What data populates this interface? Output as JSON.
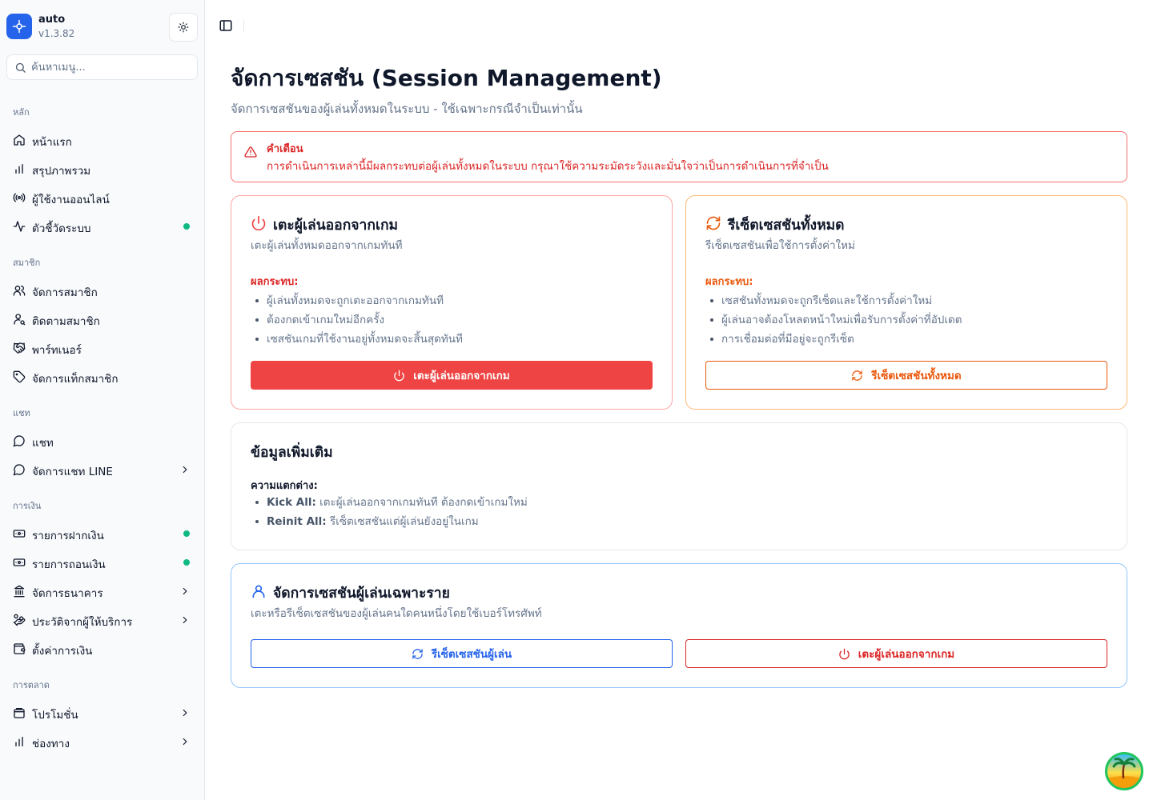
{
  "brand": {
    "name": "auto",
    "version": "v1.3.82"
  },
  "search": {
    "placeholder": "ค้นหาเมนู..."
  },
  "sections": {
    "main": "หลัก",
    "members": "สมาชิก",
    "chat": "แชท",
    "finance": "การเงิน",
    "marketing": "การตลาด"
  },
  "nav": {
    "home": "หน้าแรก",
    "overview": "สรุปภาพรวม",
    "online": "ผู้ใช้งานออนไลน์",
    "metrics": "ตัวชี้วัดระบบ",
    "members": "จัดการสมาชิก",
    "follow": "ติดตามสมาชิก",
    "partner": "พาร์ทเนอร์",
    "tags": "จัดการแท็กสมาชิก",
    "chat": "แชท",
    "line": "จัดการแชท LINE",
    "deposit": "รายการฝากเงิน",
    "withdraw": "รายการถอนเงิน",
    "bank": "จัดการธนาคาร",
    "provider": "ประวัติจากผู้ให้บริการ",
    "finance_settings": "ตั้งค่าการเงิน",
    "promo": "โปรโมชั่น",
    "channel": "ช่องทาง"
  },
  "page": {
    "title": "จัดการเซสชัน (Session Management)",
    "subtitle": "จัดการเซสชันของผู้เล่นทั้งหมดในระบบ - ใช้เฉพาะกรณีจำเป็นเท่านั้น"
  },
  "alert": {
    "title": "คำเตือน",
    "text": "การดำเนินการเหล่านี้มีผลกระทบต่อผู้เล่นทั้งหมดในระบบ กรุณาใช้ความระมัดระวังและมั่นใจว่าเป็นการดำเนินการที่จำเป็น"
  },
  "kick_card": {
    "title": "เตะผู้เล่นออกจากเกม",
    "desc": "เตะผู้เล่นทั้งหมดออกจากเกมทันที",
    "impact_label": "ผลกระทบ:",
    "bullets": [
      "ผู้เล่นทั้งหมดจะถูกเตะออกจากเกมทันที",
      "ต้องกดเข้าเกมใหม่อีกครั้ง",
      "เซสชันเกมที่ใช้งานอยู่ทั้งหมดจะสิ้นสุดทันที"
    ],
    "button": "เตะผู้เล่นออกจากเกม"
  },
  "reset_card": {
    "title": "รีเซ็ตเซสชันทั้งหมด",
    "desc": "รีเซ็ตเซสชันเพื่อใช้การตั้งค่าใหม่",
    "impact_label": "ผลกระทบ:",
    "bullets": [
      "เซสชันทั้งหมดจะถูกรีเซ็ตและใช้การตั้งค่าใหม่",
      "ผู้เล่นอาจต้องโหลดหน้าใหม่เพื่อรับการตั้งค่าที่อัปเดต",
      "การเชื่อมต่อที่มีอยู่จะถูกรีเซ็ต"
    ],
    "button": "รีเซ็ตเซสชันทั้งหมด"
  },
  "info_card": {
    "title": "ข้อมูลเพิ่มเติม",
    "diff_label": "ความแตกต่าง:",
    "items": [
      {
        "term": "Kick All:",
        "text": "เตะผู้เล่นออกจากเกมทันที ต้องกดเข้าเกมใหม่"
      },
      {
        "term": "Reinit All:",
        "text": "รีเซ็ตเซสชันแต่ผู้เล่นยังอยู่ในเกม"
      }
    ]
  },
  "player_card": {
    "title": "จัดการเซสชันผู้เล่นเฉพาะราย",
    "desc": "เตะหรือรีเซ็ตเซสชันของผู้เล่นคนใดคนหนึ่งโดยใช้เบอร์โทรศัพท์",
    "reset_button": "รีเซ็ตเซสชันผู้เล่น",
    "kick_button": "เตะผู้เล่นออกจากเกม"
  },
  "colors": {
    "primary": "#2563eb",
    "danger": "#ef4444",
    "warning": "#ea580c",
    "online": "#10b981"
  }
}
